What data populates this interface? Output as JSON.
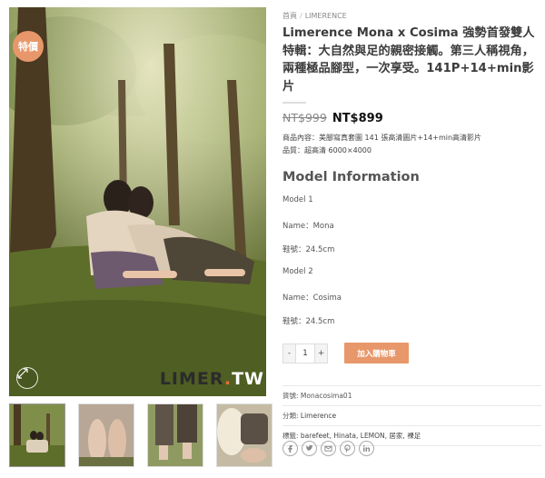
{
  "gallery": {
    "badge_label": "特價",
    "watermark": {
      "part1": "LIMER",
      "dot": ".",
      "part2": "TW"
    },
    "thumbnails": [
      {
        "name": "thumb-1",
        "active": true
      },
      {
        "name": "thumb-2",
        "active": false
      },
      {
        "name": "thumb-3",
        "active": false
      },
      {
        "name": "thumb-4",
        "active": false
      }
    ]
  },
  "breadcrumb": {
    "home": "首頁",
    "separator": "/",
    "category": "LIMERENCE"
  },
  "product": {
    "title": "Limerence Mona x Cosima 強勢首發雙人特輯：大自然與足的親密接觸。第三人稱視角，兩種極品腳型，一次享受。141P+14+min影片",
    "price_old": "NT$999",
    "price_new": "NT$899",
    "content_line": "商品內容：美腳寫真套圖 141 張高清圖片+14+min高清影片",
    "quality_line": "品質：超高清 6000×4000"
  },
  "models": {
    "heading": "Model Information",
    "lines": [
      "Model 1",
      "Name：Mona",
      "鞋號：24.5cm",
      "Model 2",
      "Name：Cosima",
      "鞋號：24.5cm"
    ]
  },
  "cart": {
    "minus": "-",
    "quantity": "1",
    "plus": "+",
    "add_to_cart": "加入購物車"
  },
  "meta": {
    "sku_label": "貨號:",
    "sku": "Monacosima01",
    "category_label": "分類:",
    "category": "Limerence",
    "tags_label": "標籤:",
    "tags": "barefeet, Hinata, LEMON, 居家, 裸足"
  },
  "share_icons": [
    "facebook-icon",
    "twitter-icon",
    "email-icon",
    "pinterest-icon",
    "linkedin-icon"
  ],
  "colors": {
    "accent": "#e8976b",
    "watermark_dot": "#e86d34"
  }
}
